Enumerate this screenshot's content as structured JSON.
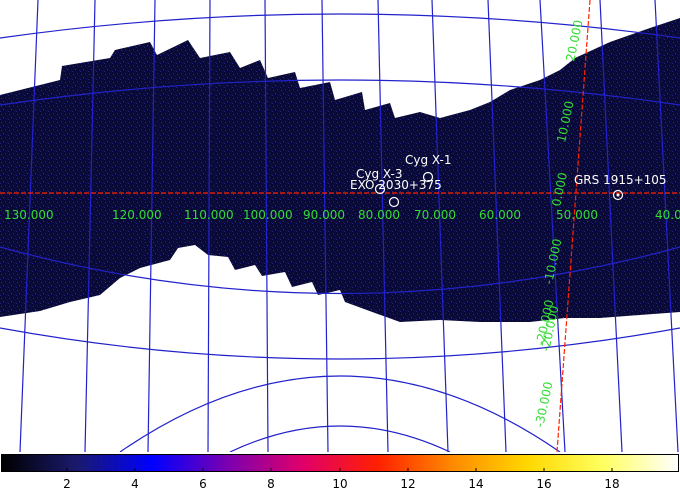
{
  "sky_map": {
    "longitude_labels": [
      "130.000",
      "120.000",
      "110.000",
      "100.000",
      "90.000",
      "80.000",
      "70.000",
      "60.000",
      "50.000",
      "40.0"
    ],
    "latitude_labels": [
      "20.000",
      "10.000",
      "0.000",
      "-10.000",
      "-20.000",
      "-20.000",
      "-30.000"
    ],
    "sources": [
      {
        "name": "Cyg X-1"
      },
      {
        "name": "Cyg X-3"
      },
      {
        "name": "EXO 2030+375"
      },
      {
        "name": "GRS 1915+105"
      }
    ],
    "colors": {
      "grid_lines": "#2222cc",
      "galactic_equator": "#ff2200",
      "coordinate_labels": "#33dd33",
      "source_labels": "#ffffff",
      "exposure_background": "#0a0a3a"
    }
  },
  "colorbar": {
    "tick_labels": [
      "2",
      "4",
      "6",
      "8",
      "10",
      "12",
      "14",
      "16",
      "18"
    ],
    "colormap": [
      "#000000",
      "#1a1a6e",
      "#0000ff",
      "#7a00b0",
      "#e0006a",
      "#ff2000",
      "#ff8a00",
      "#ffd800",
      "#ffff60",
      "#ffffff"
    ]
  }
}
